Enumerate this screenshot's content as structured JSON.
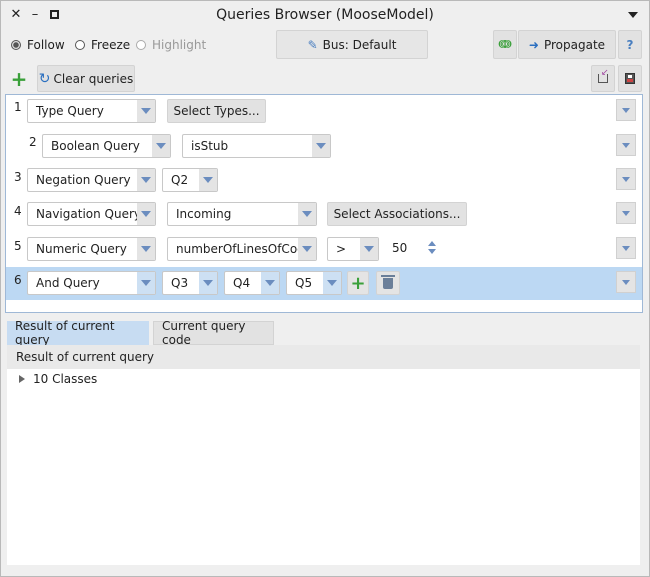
{
  "window": {
    "title": "Queries Browser (MooseModel)"
  },
  "toolbar": {
    "follow_label": "Follow",
    "freeze_label": "Freeze",
    "highlight_label": "Highlight",
    "bus_label": "Bus: Default",
    "propagate_label": "Propagate",
    "help_label": "?",
    "clear_label": "Clear queries"
  },
  "queries": [
    {
      "num": "1",
      "type": "Type Query",
      "button": "Select Types..."
    },
    {
      "num": "2",
      "type": "Boolean Query",
      "value": "isStub"
    },
    {
      "num": "3",
      "type": "Negation Query",
      "value": "Q2"
    },
    {
      "num": "4",
      "type": "Navigation Query",
      "value": "Incoming",
      "button": "Select Associations..."
    },
    {
      "num": "5",
      "type": "Numeric Query",
      "value": "numberOfLinesOfCode",
      "operator": ">",
      "number": "50"
    },
    {
      "num": "6",
      "type": "And Query",
      "operands": [
        "Q3",
        "Q4",
        "Q5"
      ]
    }
  ],
  "tabs": {
    "result": "Result of current query",
    "code": "Current query code"
  },
  "result": {
    "header": "Result of current query",
    "item": "10 Classes"
  },
  "colors": {
    "selection": "#bcd8f3",
    "accent": "#6b8dbf",
    "add_green": "#3aa03a"
  }
}
